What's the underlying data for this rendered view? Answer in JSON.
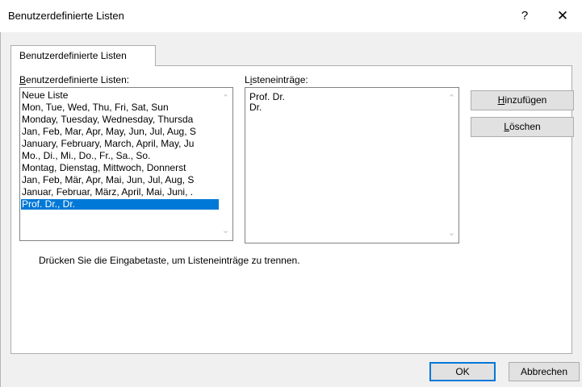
{
  "window": {
    "title": "Benutzerdefinierte Listen",
    "help_glyph": "?",
    "close_glyph": "✕"
  },
  "tab": {
    "label": "Benutzerdefinierte Listen"
  },
  "lists_label": "Benutzerdefinierte Listen:",
  "entries_label": "Listeneinträge:",
  "lists": [
    "Neue Liste",
    "Mon, Tue, Wed, Thu, Fri, Sat, Sun",
    "Monday, Tuesday, Wednesday, Thursda",
    "Jan, Feb, Mar, Apr, May, Jun, Jul, Aug, S",
    "January, February, March, April, May, Ju",
    "Mo., Di., Mi., Do., Fr., Sa., So.",
    "Montag, Dienstag, Mittwoch, Donnerst",
    "Jan, Feb, Mär, Apr, Mai, Jun, Jul, Aug, S",
    "Januar, Februar, März, April, Mai, Juni, .",
    "Prof. Dr., Dr."
  ],
  "selected_list_index": 9,
  "entries": [
    "Prof. Dr.",
    "Dr."
  ],
  "buttons": {
    "add": "Hinzufügen",
    "delete": "Löschen",
    "ok": "OK",
    "cancel": "Abbrechen"
  },
  "hint": "Drücken Sie die Eingabetaste, um Listeneinträge zu trennen.",
  "colors": {
    "selection": "#0078d7",
    "default_button_border": "#0078d7"
  },
  "scroll_up_glyph": "⌃",
  "scroll_down_glyph": "⌄"
}
